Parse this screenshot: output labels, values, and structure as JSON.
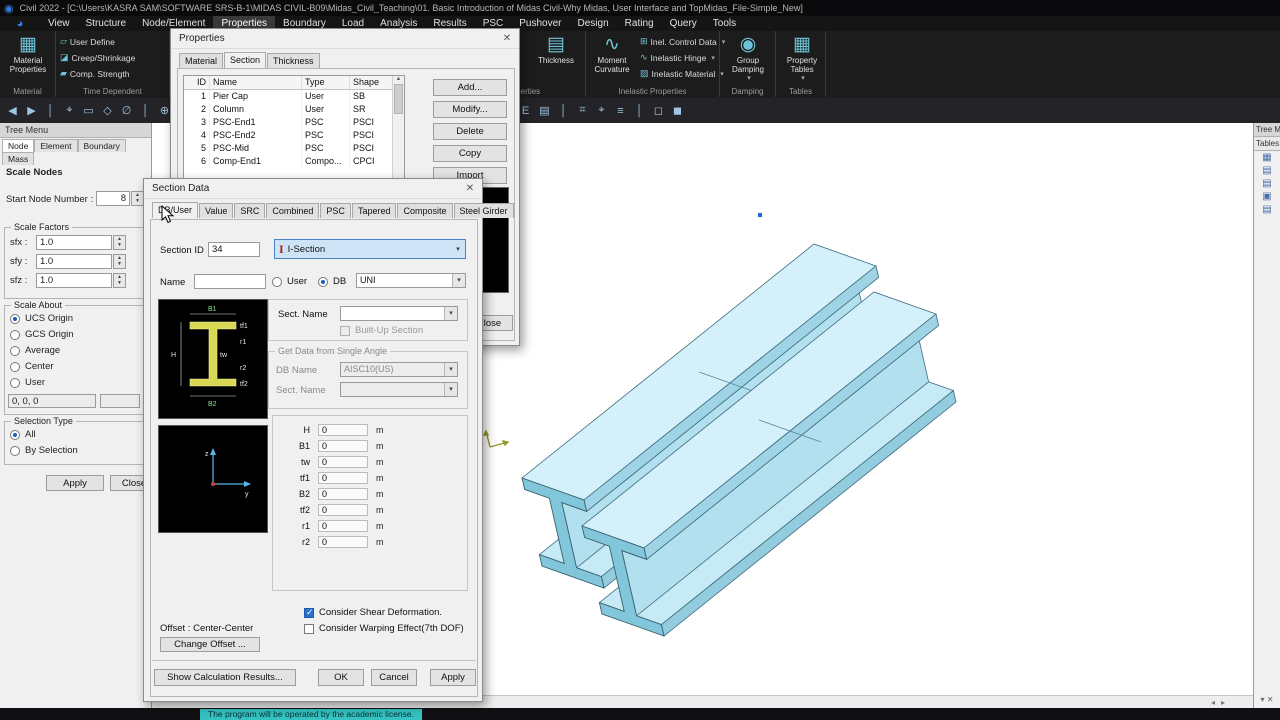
{
  "title_bar": {
    "title": "Civil 2022 - [C:\\Users\\KASRA SAM\\SOFTWARE SRS-B-1\\MIDAS CIVIL-B09\\Midas_Civil_Teaching\\01. Basic Introduction of Midas Civil-Why Midas, User Interface and TopMidas_File-Simple_New]"
  },
  "menu": {
    "active": "Properties",
    "items": [
      "View",
      "Structure",
      "Node/Element",
      "Properties",
      "Boundary",
      "Load",
      "Analysis",
      "Results",
      "PSC",
      "Pushover",
      "Design",
      "Rating",
      "Query",
      "Tools"
    ]
  },
  "ribbon": {
    "material": {
      "icon": "▦",
      "line1": "Material",
      "line2": "Properties",
      "group": "Material"
    },
    "time_dependent": {
      "group": "Time Dependent",
      "items": [
        {
          "icon": "▱",
          "label": "User Define"
        },
        {
          "icon": "◪",
          "label": "Creep/Shrinkage"
        },
        {
          "icon": "▰",
          "label": "Comp. Strength"
        }
      ]
    },
    "section_properties": {
      "group": "Section Properties",
      "thickness_icon": "▤",
      "thickness_label": "Thickness"
    },
    "inelastic": {
      "group": "Inelastic Properties",
      "moment_icon": "∿",
      "moment_line1": "Moment",
      "moment_line2": "Curvature",
      "items": [
        {
          "icon": "⊞",
          "label": "Inel. Control Data"
        },
        {
          "icon": "∿",
          "label": "Inelastic Hinge"
        },
        {
          "icon": "▨",
          "label": "Inelastic Material"
        }
      ]
    },
    "damping": {
      "icon": "◉",
      "line1": "Group",
      "line2": "Damping",
      "group": "Damping"
    },
    "tables": {
      "icon": "▦",
      "line1": "Property",
      "line2": "Tables",
      "group": "Tables"
    }
  },
  "toolbar": {
    "icons": [
      {
        "glyph": "◀"
      },
      {
        "glyph": "▶"
      },
      {
        "glyph": "│"
      },
      {
        "glyph": "⌖"
      },
      {
        "glyph": "▭"
      },
      {
        "glyph": "◇"
      },
      {
        "glyph": "∅"
      },
      {
        "glyph": "│"
      },
      {
        "glyph": "⊕"
      },
      {
        "glyph": "⊖"
      },
      {
        "glyph": "⊡"
      },
      {
        "glyph": "⊞"
      },
      {
        "glyph": "+"
      },
      {
        "glyph": "│"
      },
      {
        "glyph": "◧"
      },
      {
        "glyph": "◨"
      },
      {
        "glyph": "◩"
      },
      {
        "glyph": "◪"
      },
      {
        "glyph": "⟲"
      },
      {
        "glyph": "⟳"
      },
      {
        "glyph": "│"
      },
      {
        "glyph": "▦"
      },
      {
        "glyph": "▧"
      },
      {
        "glyph": "▨"
      },
      {
        "glyph": "▥"
      },
      {
        "glyph": "│"
      },
      {
        "glyph": "N"
      },
      {
        "glyph": "E"
      },
      {
        "glyph": "▤"
      },
      {
        "glyph": "│"
      },
      {
        "glyph": "⌗"
      },
      {
        "glyph": "⌖"
      },
      {
        "glyph": "≡"
      },
      {
        "glyph": "│"
      },
      {
        "glyph": "◻"
      },
      {
        "glyph": "◼"
      }
    ]
  },
  "tree_panel": {
    "title": "Tree Menu",
    "tabs": [
      "Node",
      "Element",
      "Boundary",
      "Mass"
    ],
    "active_tab": "Node",
    "section_title": "Scale Nodes",
    "start_node_label": "Start Node Number :",
    "start_node_value": "8",
    "scale_factors": {
      "title": "Scale Factors",
      "rows": [
        {
          "label": "sfx :",
          "value": "1.0"
        },
        {
          "label": "sfy :",
          "value": "1.0"
        },
        {
          "label": "sfz :",
          "value": "1.0"
        }
      ]
    },
    "scale_about": {
      "title": "Scale About",
      "options": [
        "UCS Origin",
        "GCS Origin",
        "Average",
        "Center",
        "User"
      ],
      "selected": "UCS Origin",
      "coords": "0, 0, 0"
    },
    "selection_type": {
      "title": "Selection Type",
      "options": [
        "All",
        "By Selection"
      ],
      "selected": "All"
    },
    "apply": "Apply",
    "close": "Close"
  },
  "properties_dialog": {
    "title": "Properties",
    "close_glyph": "✕",
    "tabs": [
      "Material",
      "Section",
      "Thickness"
    ],
    "active_tab": "Section",
    "columns": [
      "ID",
      "Name",
      "Type",
      "Shape"
    ],
    "rows": [
      {
        "id": "1",
        "name": "Pier Cap",
        "type": "User",
        "shape": "SB"
      },
      {
        "id": "2",
        "name": "Column",
        "type": "User",
        "shape": "SR"
      },
      {
        "id": "3",
        "name": "PSC-End1",
        "type": "PSC",
        "shape": "PSCI"
      },
      {
        "id": "4",
        "name": "PSC-End2",
        "type": "PSC",
        "shape": "PSCI"
      },
      {
        "id": "5",
        "name": "PSC-Mid",
        "type": "PSC",
        "shape": "PSCI"
      },
      {
        "id": "6",
        "name": "Comp-End1",
        "type": "Compo...",
        "shape": "CPCI"
      }
    ],
    "buttons": {
      "add": "Add...",
      "modify": "Modify...",
      "delete": "Delete",
      "copy": "Copy",
      "import": "Import",
      "close": "Close"
    }
  },
  "section_dialog": {
    "title": "Section Data",
    "close_glyph": "✕",
    "tabs": [
      "DB/User",
      "Value",
      "SRC",
      "Combined",
      "PSC",
      "Tapered",
      "Composite",
      "Steel Girder"
    ],
    "active_tab": "DB/User",
    "section_id_label": "Section ID",
    "section_id": "34",
    "shape_icon": "I",
    "shape_combo": "I-Section",
    "name_label": "Name",
    "name_value": "",
    "user_radio": "User",
    "db_radio": "DB",
    "db_combo": "UNI",
    "sect_name_label": "Sect. Name",
    "sect_name_value": "",
    "built_up_label": "Built-Up Section",
    "angle_group": "Get Data from Single Angle",
    "db_name_label": "DB Name",
    "db_name_value": "AISC10(US)",
    "sect_name2_label": "Sect. Name",
    "sect_name2_value": "",
    "params": [
      {
        "label": "H",
        "value": "0",
        "unit": "m"
      },
      {
        "label": "B1",
        "value": "0",
        "unit": "m"
      },
      {
        "label": "tw",
        "value": "0",
        "unit": "m"
      },
      {
        "label": "tf1",
        "value": "0",
        "unit": "m"
      },
      {
        "label": "B2",
        "value": "0",
        "unit": "m"
      },
      {
        "label": "tf2",
        "value": "0",
        "unit": "m"
      },
      {
        "label": "r1",
        "value": "0",
        "unit": "m"
      },
      {
        "label": "r2",
        "value": "0",
        "unit": "m"
      }
    ],
    "shear_check": "Consider Shear Deformation.",
    "warp_check": "Consider Warping Effect(7th DOF)",
    "offset_label": "Offset :",
    "offset_value": "Center-Center",
    "change_offset": "Change Offset ...",
    "show_calc": "Show Calculation Results...",
    "ok": "OK",
    "cancel": "Cancel",
    "apply": "Apply",
    "preview_labels": {
      "b1": "B1",
      "tf1": "tf1",
      "r1": "r1",
      "tw": "tw",
      "r2": "r2",
      "tf2": "tf2",
      "b2": "B2",
      "h": "H"
    },
    "axis_labels": {
      "z": "z",
      "y": "y"
    }
  },
  "right_panel": {
    "title": "Tree Me",
    "header": "Tables",
    "items": [
      {
        "glyph": "▦"
      },
      {
        "glyph": "▤"
      },
      {
        "glyph": "▤"
      },
      {
        "glyph": "▣"
      },
      {
        "glyph": "▤"
      }
    ],
    "pin_glyph": "▾",
    "close_glyph": "✕"
  },
  "view_toolbar": {
    "buttons": [
      {
        "glyph": "⊞"
      },
      {
        "glyph": "⊠"
      },
      {
        "glyph": "◧"
      },
      {
        "glyph": "◨"
      },
      {
        "glyph": "◰"
      },
      {
        "glyph": "◳"
      }
    ]
  },
  "hscroll": {
    "left_glyph": "◂",
    "right_glyph": "▸"
  },
  "status": {
    "message": "The program will be operated by the academic license."
  },
  "colors": {
    "accent_blue": "#2a70c8",
    "girder_fill_top": "#d4f0fa",
    "girder_fill_side": "#9fd4e7",
    "girder_edge": "#3d6b7c",
    "selection_teal": "#35c2c2",
    "preview_yellow": "#d8d855"
  }
}
